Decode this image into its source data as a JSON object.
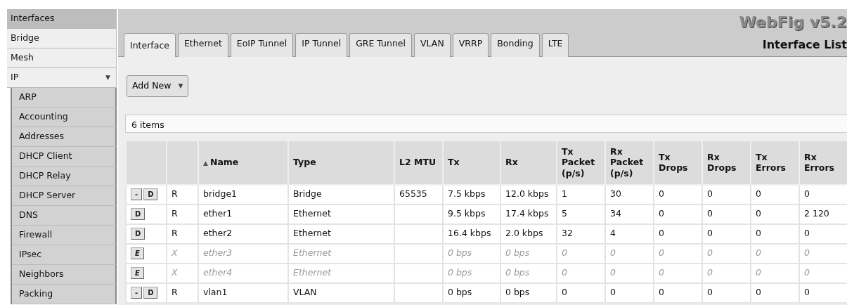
{
  "sidebar": {
    "items": [
      {
        "label": "Interfaces",
        "selected": true
      },
      {
        "label": "Bridge",
        "selected": false
      },
      {
        "label": "Mesh",
        "selected": false
      },
      {
        "label": "IP",
        "selected": false,
        "expanded": true,
        "arrow": "▼",
        "children": [
          {
            "label": "ARP",
            "selected": false
          },
          {
            "label": "Accounting",
            "selected": false
          },
          {
            "label": "Addresses",
            "selected": false
          },
          {
            "label": "DHCP Client",
            "selected": false
          },
          {
            "label": "DHCP Relay",
            "selected": false
          },
          {
            "label": "DHCP Server",
            "selected": false
          },
          {
            "label": "DNS",
            "selected": false
          },
          {
            "label": "Firewall",
            "selected": false
          },
          {
            "label": "IPsec",
            "selected": false
          },
          {
            "label": "Neighbors",
            "selected": false
          },
          {
            "label": "Packing",
            "selected": false
          }
        ]
      }
    ]
  },
  "header": {
    "brand": "WebFig v5.2",
    "page_title": "Interface List"
  },
  "tabs": [
    {
      "label": "Interface",
      "selected": true
    },
    {
      "label": "Ethernet",
      "selected": false
    },
    {
      "label": "EoIP Tunnel",
      "selected": false
    },
    {
      "label": "IP Tunnel",
      "selected": false
    },
    {
      "label": "GRE Tunnel",
      "selected": false
    },
    {
      "label": "VLAN",
      "selected": false
    },
    {
      "label": "VRRP",
      "selected": false
    },
    {
      "label": "Bonding",
      "selected": false
    },
    {
      "label": "LTE",
      "selected": false
    }
  ],
  "add_button": {
    "label": "Add New",
    "arrow": "▼"
  },
  "item_count": "6 items",
  "table": {
    "columns": [
      {},
      {},
      {
        "label": "Name",
        "sort": "▲"
      },
      {
        "label": "Type"
      },
      {
        "label": "L2 MTU"
      },
      {
        "label": "Tx"
      },
      {
        "label": "Rx"
      },
      {
        "label": "Tx Packet (p/s)"
      },
      {
        "label": "Rx Packet (p/s)"
      },
      {
        "label": "Tx Drops"
      },
      {
        "label": "Rx Drops"
      },
      {
        "label": "Tx Errors"
      },
      {
        "label": "Rx Errors"
      }
    ],
    "rows": [
      {
        "disabled": false,
        "actions": [
          {
            "kind": "remove",
            "label": "-"
          },
          {
            "kind": "disable",
            "label": "D"
          }
        ],
        "cells": [
          "",
          "R",
          "bridge1",
          "Bridge",
          "65535",
          "7.5 kbps",
          "12.0 kbps",
          "1",
          "30",
          "0",
          "0",
          "0",
          "0"
        ]
      },
      {
        "disabled": false,
        "actions": [
          {
            "kind": "disable",
            "label": "D"
          }
        ],
        "cells": [
          "",
          "R",
          "ether1",
          "Ethernet",
          "",
          "9.5 kbps",
          "17.4 kbps",
          "5",
          "34",
          "0",
          "0",
          "0",
          "2 120"
        ]
      },
      {
        "disabled": false,
        "actions": [
          {
            "kind": "disable",
            "label": "D"
          }
        ],
        "cells": [
          "",
          "R",
          "ether2",
          "Ethernet",
          "",
          "16.4 kbps",
          "2.0 kbps",
          "32",
          "4",
          "0",
          "0",
          "0",
          "0"
        ]
      },
      {
        "disabled": true,
        "actions": [
          {
            "kind": "enable",
            "label": "E"
          }
        ],
        "cells": [
          "",
          "X",
          "ether3",
          "Ethernet",
          "",
          "0 bps",
          "0 bps",
          "0",
          "0",
          "0",
          "0",
          "0",
          "0"
        ]
      },
      {
        "disabled": true,
        "actions": [
          {
            "kind": "enable",
            "label": "E"
          }
        ],
        "cells": [
          "",
          "X",
          "ether4",
          "Ethernet",
          "",
          "0 bps",
          "0 bps",
          "0",
          "0",
          "0",
          "0",
          "0",
          "0"
        ]
      },
      {
        "disabled": false,
        "actions": [
          {
            "kind": "remove",
            "label": "-"
          },
          {
            "kind": "disable",
            "label": "D"
          }
        ],
        "cells": [
          "",
          "R",
          "vlan1",
          "VLAN",
          "",
          "0 bps",
          "0 bps",
          "0",
          "0",
          "0",
          "0",
          "0",
          "0"
        ]
      }
    ]
  }
}
